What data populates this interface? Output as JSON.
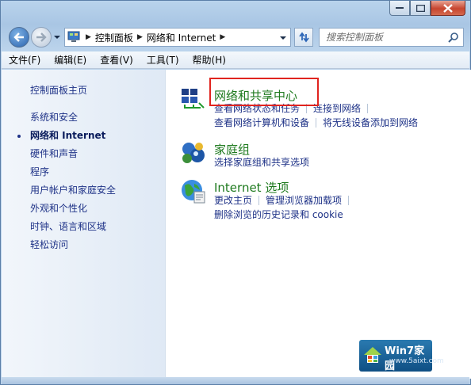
{
  "window": {
    "minimize_glyph": "–",
    "close_glyph": "✕"
  },
  "address": {
    "crumbs": [
      "控制面板",
      "网络和 Internet"
    ]
  },
  "search": {
    "placeholder": "搜索控制面板"
  },
  "menu": [
    "文件(F)",
    "编辑(E)",
    "查看(V)",
    "工具(T)",
    "帮助(H)"
  ],
  "sidebar": {
    "items": [
      {
        "label": "控制面板主页"
      },
      {
        "label": "系统和安全"
      },
      {
        "label": "网络和 Internet"
      },
      {
        "label": "硬件和声音"
      },
      {
        "label": "程序"
      },
      {
        "label": "用户帐户和家庭安全"
      },
      {
        "label": "外观和个性化"
      },
      {
        "label": "时钟、语言和区域"
      },
      {
        "label": "轻松访问"
      }
    ]
  },
  "categories": {
    "network": {
      "title": "网络和共享中心",
      "links": [
        "查看网络状态和任务",
        "连接到网络",
        "查看网络计算机和设备",
        "将无线设备添加到网络"
      ]
    },
    "homegroup": {
      "title": "家庭组",
      "links": [
        "选择家庭组和共享选项"
      ]
    },
    "internet": {
      "title": "Internet 选项",
      "links": [
        "更改主页",
        "管理浏览器加载项",
        "删除浏览的历史记录和 cookie"
      ]
    }
  },
  "watermark": {
    "title": "Win7家园",
    "url": "www.5aixt.com"
  },
  "colors": {
    "link": "#1e3287",
    "category_title": "#1e7a1e",
    "highlight": "#e0241f"
  }
}
